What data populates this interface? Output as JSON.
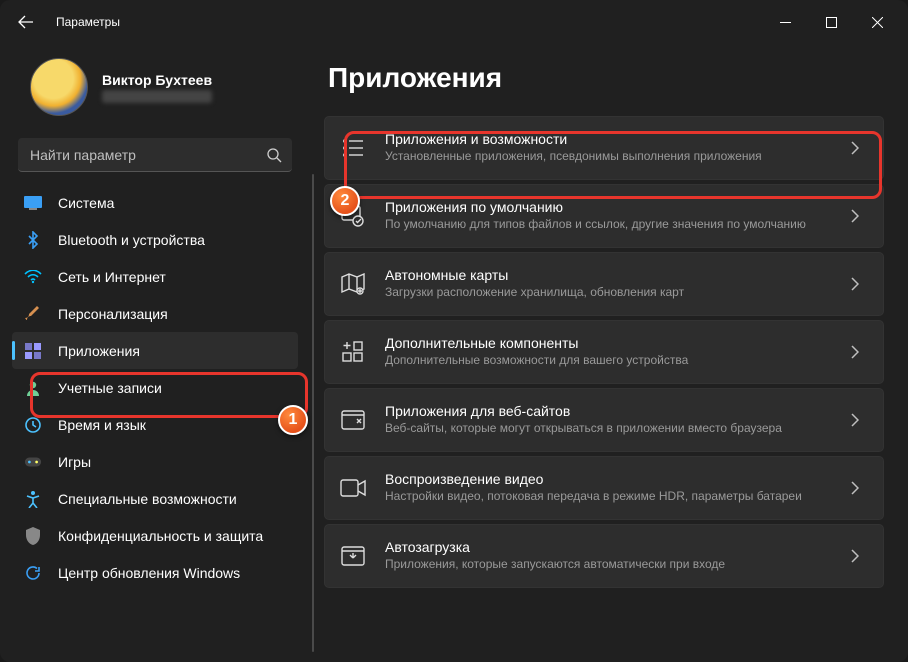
{
  "window": {
    "title": "Параметры"
  },
  "profile": {
    "name": "Виктор Бухтеев"
  },
  "search": {
    "placeholder": "Найти параметр"
  },
  "nav": {
    "items": [
      {
        "label": "Система"
      },
      {
        "label": "Bluetooth и устройства"
      },
      {
        "label": "Сеть и Интернет"
      },
      {
        "label": "Персонализация"
      },
      {
        "label": "Приложения"
      },
      {
        "label": "Учетные записи"
      },
      {
        "label": "Время и язык"
      },
      {
        "label": "Игры"
      },
      {
        "label": "Специальные возможности"
      },
      {
        "label": "Конфиденциальность и защита"
      },
      {
        "label": "Центр обновления Windows"
      }
    ]
  },
  "page": {
    "title": "Приложения"
  },
  "cards": [
    {
      "title": "Приложения и возможности",
      "sub": "Установленные приложения, псевдонимы выполнения приложения"
    },
    {
      "title": "Приложения по умолчанию",
      "sub": "По умолчанию для типов файлов и ссылок, другие значения по умолчанию"
    },
    {
      "title": "Автономные карты",
      "sub": "Загрузки расположение хранилища, обновления карт"
    },
    {
      "title": "Дополнительные компоненты",
      "sub": "Дополнительные возможности для вашего устройства"
    },
    {
      "title": "Приложения для веб-сайтов",
      "sub": "Веб-сайты, которые могут открываться в приложении вместо браузера"
    },
    {
      "title": "Воспроизведение видео",
      "sub": "Настройки видео, потоковая передача в режиме HDR, параметры батареи"
    },
    {
      "title": "Автозагрузка",
      "sub": "Приложения, которые запускаются автоматически при входе"
    }
  ],
  "annotations": {
    "badge1": "1",
    "badge2": "2"
  }
}
